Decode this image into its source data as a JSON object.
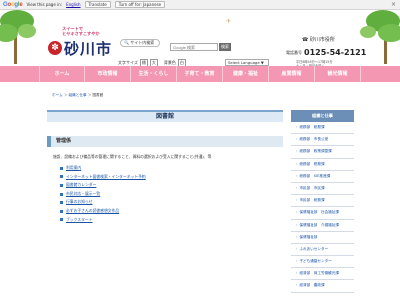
{
  "translate_bar": {
    "logo": [
      "G",
      "o",
      "o",
      "g",
      "l",
      "e"
    ],
    "view_in": "View this page in:",
    "language": "English",
    "translate_button": "Translate",
    "turn_off": "Turn off for: Japanese",
    "close": "×"
  },
  "header": {
    "slogan_line1": "スイートで",
    "slogan_line2": "ヒヤキさすこすやか",
    "city_name": "砂川市",
    "sitemap_label": "サイト内検索",
    "font_size_label": "文字サイズ",
    "font_size_small": "標",
    "font_size_large": "大",
    "bg_color_label": "背景色",
    "bg_color_option": "白",
    "search_placeholder": "Google 検索",
    "search_button": "検索",
    "language_select": "Select Language ▼",
    "city_hall": "砂川市役所",
    "phone_label": "電話番号",
    "phone_number": "0125-54-2121",
    "address_line1": "平日8時45分〜17時15分",
    "address_line2": "土・日・祝日を除く"
  },
  "nav": {
    "items": [
      "ホーム",
      "市政情報",
      "生活・くらし",
      "子育て・教育",
      "健康・福祉",
      "産業情報",
      "観光情報"
    ]
  },
  "breadcrumb": {
    "items": [
      "ホーム",
      "組織と仕事",
      "図書館"
    ],
    "separator": "＞"
  },
  "main": {
    "title": "図書館",
    "section_title": "管理係",
    "description": "施設、設備および備品等の管理に関すること、資料の選択および受入に関すること(共通)、等",
    "links": [
      "利用案内",
      "インターネット図書検索・インターネット予約",
      "図書館カレンダー",
      "市民対応・展示一覧",
      "行事のお知らせ",
      "必ずお子さんの読書感想文作品",
      "ブックスタート"
    ]
  },
  "sidebar": {
    "title": "組織と仕事",
    "items": [
      "総務部　総務課",
      "総務部　市長公室",
      "総務部　政策調整課",
      "総務部　税務課",
      "総務部　SIE推進課",
      "市民部　市民課",
      "市民部　総務課",
      "保健福祉部　社会福祉課",
      "保健福祉部　介護福祉課",
      "保健福祉部",
      "ふれあいセンター",
      "子ども通園センター",
      "経済部　商工労働観光課",
      "経済部　農政課"
    ]
  },
  "colors": {
    "nav_pink": "#f397b2",
    "city_name_navy": "#1c2f6e",
    "section_blue": "#6c9ac0",
    "link_blue": "#1a55a8"
  }
}
